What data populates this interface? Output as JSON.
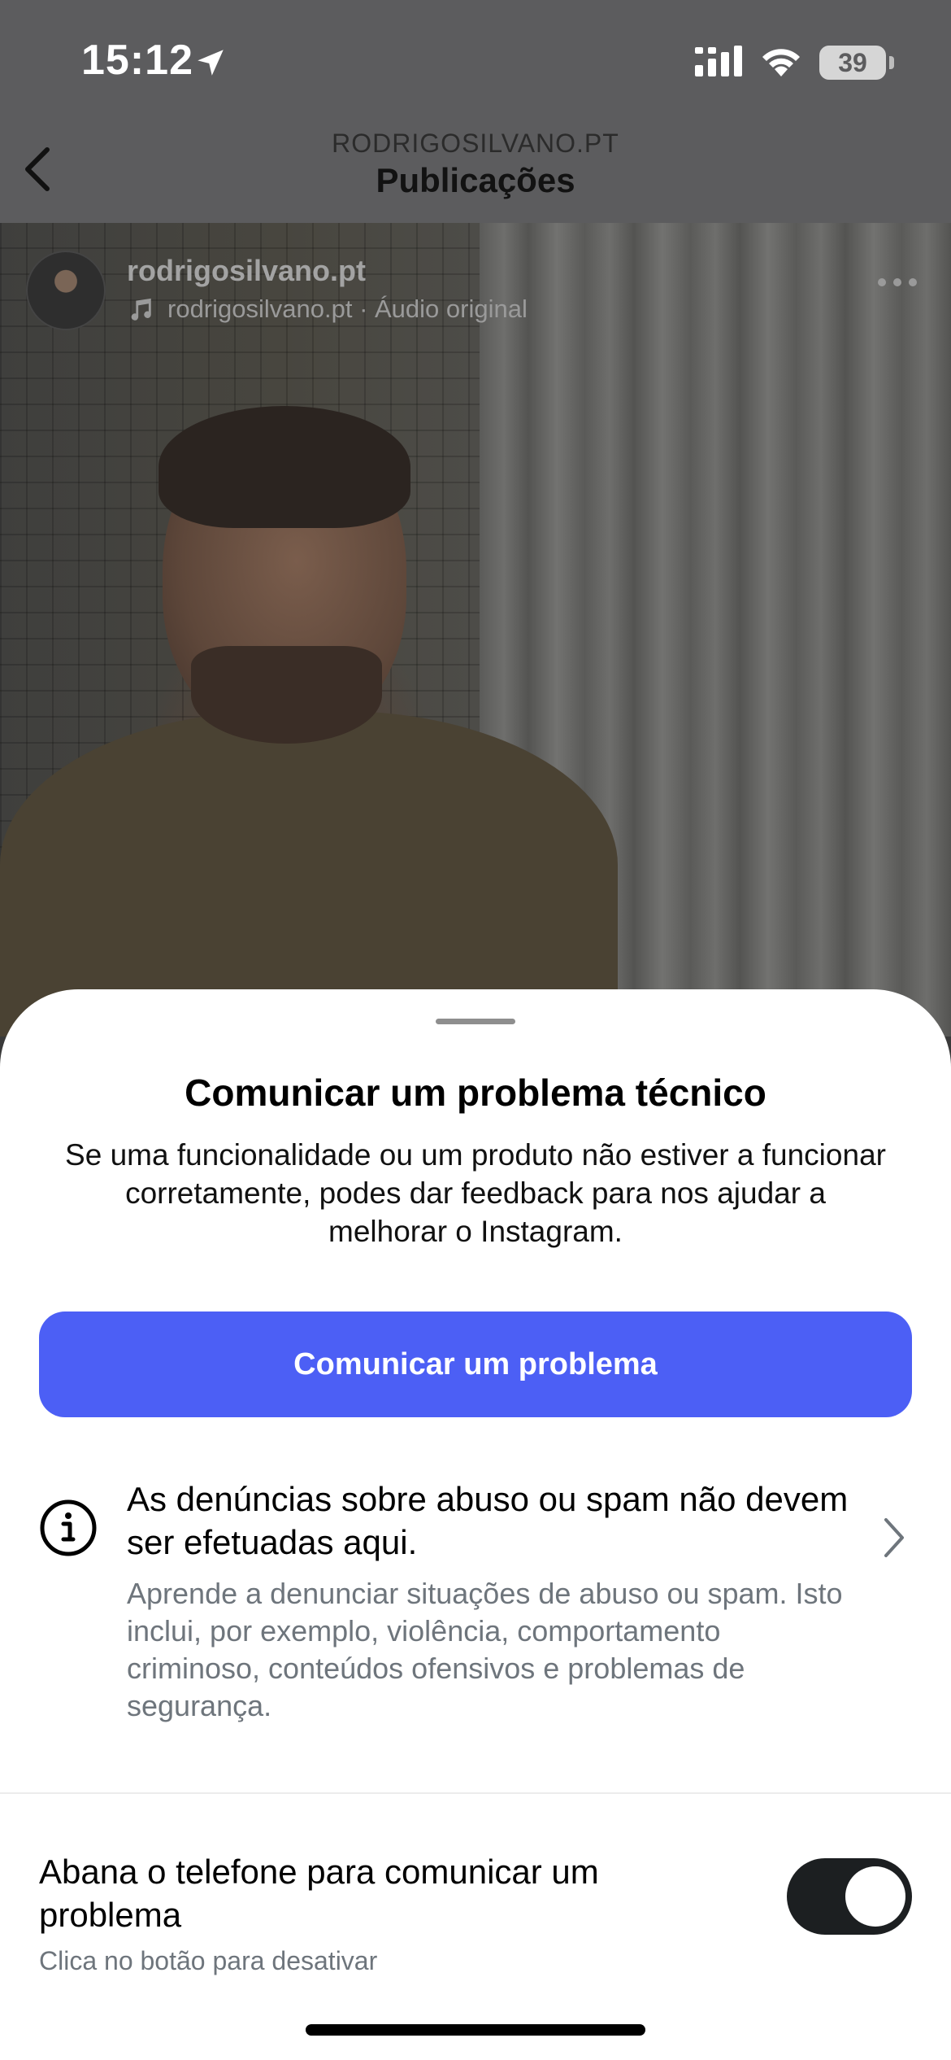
{
  "status_bar": {
    "time": "15:12",
    "battery": "39",
    "icons": [
      "location-arrow-icon",
      "signal-icon",
      "wifi-icon",
      "battery-icon"
    ]
  },
  "nav": {
    "subtitle": "RODRIGOSILVANO.PT",
    "title": "Publicações",
    "back_icon": "chevron-left-icon"
  },
  "post": {
    "author": "rodrigosilvano.pt",
    "audio": "rodrigosilvano.pt · Áudio original",
    "icons": [
      "music-note-icon",
      "more-options-icon"
    ]
  },
  "sheet": {
    "title": "Comunicar um problema técnico",
    "description": "Se uma funcionalidade ou um produto não estiver a funcionar corretamente, podes dar feedback para nos ajudar a melhorar o Instagram.",
    "report_button": "Comunicar um problema",
    "info_title": "As denúncias sobre abuso ou spam não devem ser efetuadas aqui.",
    "info_description": "Aprende a denunciar situações de abuso ou spam. Isto inclui, por exemplo, violência, comportamento criminoso, conteúdos ofensivos e problemas de segurança.",
    "shake_label": "Abana o telefone para comunicar um problema",
    "shake_sub": "Clica no botão para desativar",
    "shake_enabled": true
  },
  "colors": {
    "accent": "#4c5ff5",
    "toggle_on": "#1c1f21",
    "secondary_text": "#6e757c"
  }
}
